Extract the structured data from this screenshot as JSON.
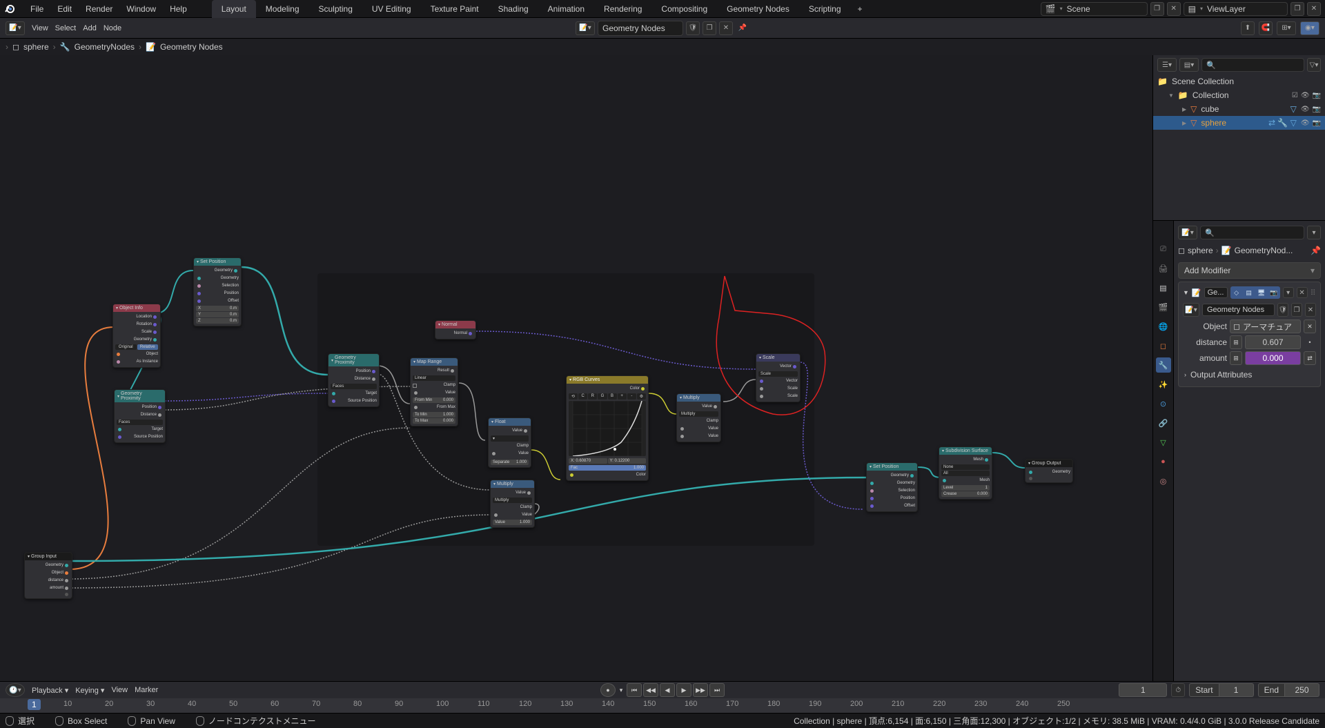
{
  "menu": {
    "file": "File",
    "edit": "Edit",
    "render": "Render",
    "window": "Window",
    "help": "Help"
  },
  "workspaces": [
    "Layout",
    "Modeling",
    "Sculpting",
    "UV Editing",
    "Texture Paint",
    "Shading",
    "Animation",
    "Rendering",
    "Compositing",
    "Geometry Nodes",
    "Scripting"
  ],
  "workspace_active": "Layout",
  "scene_name": "Scene",
  "view_layer": "ViewLayer",
  "toolbar2": {
    "view": "View",
    "select": "Select",
    "add": "Add",
    "node": "Node",
    "geometry_nodes": "Geometry Nodes"
  },
  "breadcrumb": {
    "obj": "sphere",
    "mod": "GeometryNodes",
    "tree": "Geometry Nodes"
  },
  "outliner": {
    "scene_collection": "Scene Collection",
    "collection": "Collection",
    "items": [
      {
        "name": "cube",
        "active": false
      },
      {
        "name": "sphere",
        "active": true
      }
    ]
  },
  "props": {
    "breadcrumb_obj": "sphere",
    "breadcrumb_mod": "GeometryNod...",
    "add_modifier": "Add Modifier",
    "ge_short": "Ge...",
    "geometry_nodes": "Geometry Nodes",
    "object_label": "Object",
    "object_value": "アーマチュア",
    "distance_label": "distance",
    "distance_value": "0.607",
    "amount_label": "amount",
    "amount_value": "0.000",
    "output_attributes": "Output Attributes"
  },
  "timeline": {
    "playback": "Playback",
    "keying": "Keying",
    "view": "View",
    "marker": "Marker",
    "current": "1",
    "start_label": "Start",
    "start": "1",
    "end_label": "End",
    "end": "250",
    "ticks": [
      "10",
      "20",
      "30",
      "40",
      "50",
      "60",
      "70",
      "80",
      "90",
      "100",
      "110",
      "120",
      "130",
      "140",
      "150",
      "160",
      "170",
      "180",
      "190",
      "200",
      "210",
      "220",
      "230",
      "240",
      "250"
    ]
  },
  "status": {
    "hints": [
      "選択",
      "Box Select",
      "Pan View",
      "ノードコンテクストメニュー"
    ],
    "info": "Collection | sphere | 頂点:6,154 | 面:6,150 | 三角面:12,300 | オブジェクト:1/2 | メモリ: 38.5 MiB | VRAM: 0.4/4.0 GiB | 3.0.0 Release Candidate"
  },
  "nodes": {
    "group_input": {
      "title": "Group Input",
      "sockets": [
        "Geometry",
        "Object",
        "distance",
        "amount"
      ]
    },
    "object_info": {
      "title": "Object Info",
      "o": [
        "Location",
        "Rotation",
        "Scale",
        "Geometry"
      ],
      "btns": [
        "Original",
        "Relative"
      ],
      "i": [
        "Object",
        "As Instance"
      ]
    },
    "set_position1": {
      "title": "Set Position",
      "o": [
        "Geometry"
      ],
      "i": [
        "Geometry",
        "Selection",
        "Position",
        "Offset"
      ],
      "xyz": [
        "X",
        "Y",
        "Z"
      ],
      "z": "0.m"
    },
    "geometry_proximity1": {
      "title": "Geometry Proximity",
      "o": [
        "Position",
        "Distance"
      ],
      "dd": "Faces",
      "i": [
        "Target",
        "Source Position"
      ]
    },
    "geometry_proximity2": {
      "title": "Geometry Proximity",
      "o": [
        "Position",
        "Distance"
      ],
      "dd": "Faces",
      "i": [
        "Target",
        "Source Position"
      ]
    },
    "normal": {
      "title": "Normal",
      "o": "Normal"
    },
    "map_range": {
      "title": "Map Range",
      "o": "Result",
      "dd": "Linear",
      "clamp": "Clamp",
      "rows": [
        "From Min",
        "From Max",
        "To Min",
        "To Max"
      ],
      "vals": [
        "0.000",
        "1.000",
        "1.000",
        "0.000"
      ],
      "i": "Value"
    },
    "float1": {
      "title": "Float",
      "o": "Value",
      "dd": "Clamp",
      "i": "Value",
      "lbl": "Separate",
      "v": "1.000"
    },
    "multiply1": {
      "title": "Multiply",
      "o": "Value",
      "dd": "Multiply",
      "clamp": "Clamp",
      "i": [
        "Value",
        "Value"
      ],
      "v": "1.000"
    },
    "rgb_curves": {
      "title": "RGB Curves",
      "o": "Color",
      "x": "X: 0.60870",
      "y": "Y: 0.12200",
      "fac": "Fac",
      "fv": "1.000",
      "i": "Color"
    },
    "multiply2": {
      "title": "Multiply",
      "o": "Value",
      "dd": "Multiply",
      "clamp": "Clamp",
      "i": [
        "Value",
        "Value"
      ]
    },
    "scale": {
      "title": "Scale",
      "o": "Vector",
      "i": [
        "Vector",
        "Scale",
        "Scale"
      ]
    },
    "set_position2": {
      "title": "Set Position",
      "o": "Geometry",
      "i": [
        "Geometry",
        "Selection",
        "Position",
        "Offset"
      ]
    },
    "subdiv": {
      "title": "Subdivision Surface",
      "o": "Mesh",
      "dd1": "None",
      "dd2": "All",
      "i": [
        "Mesh",
        "Level",
        "Crease"
      ],
      "v": [
        "1",
        "0.000"
      ]
    },
    "group_output": {
      "title": "Group Output",
      "i": "Geometry"
    }
  }
}
